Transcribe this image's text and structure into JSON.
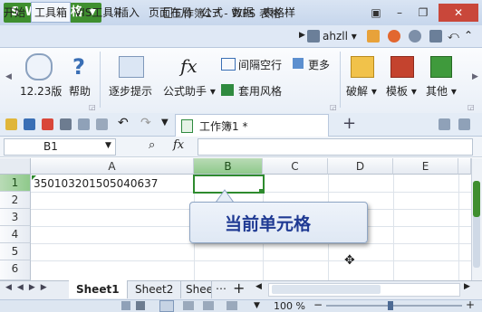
{
  "titlebar": {
    "app_name": "WPS 表格",
    "app_logo": "S",
    "doc_title": "工作簿1 * - WPS 表格"
  },
  "menubar": {
    "items": [
      "开始",
      "工具箱",
      "VIS工具箱",
      "插入",
      "页面布局",
      "公式",
      "数据",
      "表格样"
    ],
    "active": "工具箱",
    "user": "ahzll"
  },
  "ribbon": {
    "version_label": "12.23版",
    "help_label": "帮助",
    "step_label": "逐步提示",
    "formula_label": "公式助手",
    "interval_label": "间隔空行",
    "more_label": "更多",
    "style_label": "套用风格",
    "crack_label": "破解",
    "template_label": "模板",
    "other_label": "其他"
  },
  "quickbar": {
    "doc_tab": "工作簿1 *",
    "add_tab": "+"
  },
  "formula": {
    "cell_ref": "B1",
    "fx": "fx",
    "zoom_icon": "magnifier-icon"
  },
  "grid": {
    "columns": [
      "A",
      "B",
      "C",
      "D",
      "E"
    ],
    "rows": [
      "1",
      "2",
      "3",
      "4",
      "5",
      "6"
    ],
    "cell_A1": "350103201505040637",
    "selected_cell": "B1"
  },
  "callout": {
    "text": "当前单元格"
  },
  "sheets": {
    "tabs": [
      "Sheet1",
      "Sheet2",
      "Shee"
    ],
    "active": "Sheet1",
    "add": "+"
  },
  "status": {
    "zoom": "100 %"
  },
  "colors": {
    "accent_green": "#3f8f2f",
    "select_green": "#2e8b2e",
    "callout_text": "#1f3a93"
  }
}
